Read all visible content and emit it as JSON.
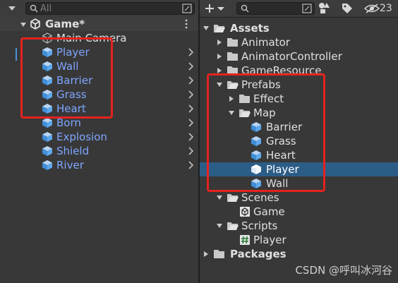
{
  "hierarchy": {
    "search_placeholder": "All",
    "scene_title": "Game*",
    "items": [
      {
        "label": "Main Camera"
      },
      {
        "label": "Player"
      },
      {
        "label": "Wall"
      },
      {
        "label": "Barrier"
      },
      {
        "label": "Grass"
      },
      {
        "label": "Heart"
      },
      {
        "label": "Born"
      },
      {
        "label": "Explosion"
      },
      {
        "label": "Shield"
      },
      {
        "label": "River"
      }
    ]
  },
  "project": {
    "hidden_count": "23",
    "root": "Assets",
    "folders": {
      "animator": "Animator",
      "animator_controller": "AnimatorController",
      "game_resource": "GameResource",
      "prefabs": "Prefabs",
      "effect": "Effect",
      "map": "Map",
      "scenes": "Scenes",
      "scripts": "Scripts",
      "packages": "Packages"
    },
    "map_items": [
      "Barrier",
      "Grass",
      "Heart",
      "Player",
      "Wall"
    ],
    "scene_file": "Game",
    "script_file": "Player"
  },
  "watermark": "CSDN @呼叫冰河谷",
  "colors": {
    "background": "#383838",
    "prefab_text": "#7ea6ff",
    "selection": "#2c5d87",
    "highlight_box": "#e5221f"
  }
}
